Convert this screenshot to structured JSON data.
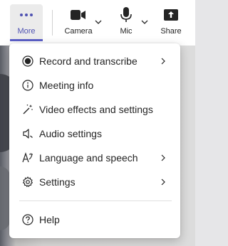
{
  "toolbar": {
    "more_label": "More",
    "camera_label": "Camera",
    "mic_label": "Mic",
    "share_label": "Share",
    "active_accent": "#5b5fc7"
  },
  "menu": {
    "items": [
      {
        "label": "Record and transcribe",
        "icon": "record-icon",
        "has_submenu": true
      },
      {
        "label": "Meeting info",
        "icon": "info-icon",
        "has_submenu": false
      },
      {
        "label": "Video effects and settings",
        "icon": "magic-wand-icon",
        "has_submenu": false
      },
      {
        "label": "Audio settings",
        "icon": "speaker-icon",
        "has_submenu": false
      },
      {
        "label": "Language and speech",
        "icon": "language-icon",
        "has_submenu": true
      },
      {
        "label": "Settings",
        "icon": "gear-icon",
        "has_submenu": true
      },
      {
        "label": "Help",
        "icon": "help-icon",
        "has_submenu": false
      }
    ]
  }
}
